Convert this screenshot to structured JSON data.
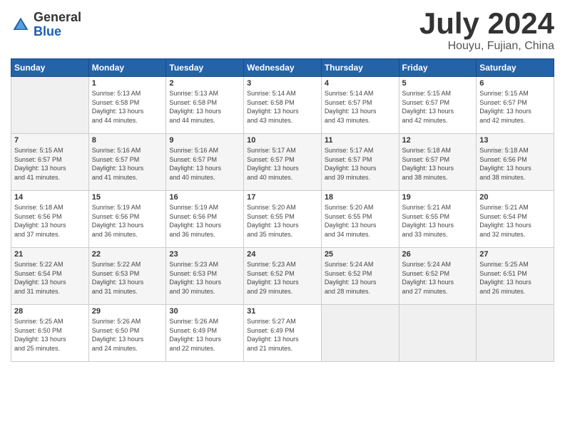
{
  "header": {
    "logo_general": "General",
    "logo_blue": "Blue",
    "month_title": "July 2024",
    "location": "Houyu, Fujian, China"
  },
  "columns": [
    "Sunday",
    "Monday",
    "Tuesday",
    "Wednesday",
    "Thursday",
    "Friday",
    "Saturday"
  ],
  "weeks": [
    {
      "days": [
        {
          "num": "",
          "info": ""
        },
        {
          "num": "1",
          "info": "Sunrise: 5:13 AM\nSunset: 6:58 PM\nDaylight: 13 hours\nand 44 minutes."
        },
        {
          "num": "2",
          "info": "Sunrise: 5:13 AM\nSunset: 6:58 PM\nDaylight: 13 hours\nand 44 minutes."
        },
        {
          "num": "3",
          "info": "Sunrise: 5:14 AM\nSunset: 6:58 PM\nDaylight: 13 hours\nand 43 minutes."
        },
        {
          "num": "4",
          "info": "Sunrise: 5:14 AM\nSunset: 6:57 PM\nDaylight: 13 hours\nand 43 minutes."
        },
        {
          "num": "5",
          "info": "Sunrise: 5:15 AM\nSunset: 6:57 PM\nDaylight: 13 hours\nand 42 minutes."
        },
        {
          "num": "6",
          "info": "Sunrise: 5:15 AM\nSunset: 6:57 PM\nDaylight: 13 hours\nand 42 minutes."
        }
      ]
    },
    {
      "days": [
        {
          "num": "7",
          "info": "Sunrise: 5:15 AM\nSunset: 6:57 PM\nDaylight: 13 hours\nand 41 minutes."
        },
        {
          "num": "8",
          "info": "Sunrise: 5:16 AM\nSunset: 6:57 PM\nDaylight: 13 hours\nand 41 minutes."
        },
        {
          "num": "9",
          "info": "Sunrise: 5:16 AM\nSunset: 6:57 PM\nDaylight: 13 hours\nand 40 minutes."
        },
        {
          "num": "10",
          "info": "Sunrise: 5:17 AM\nSunset: 6:57 PM\nDaylight: 13 hours\nand 40 minutes."
        },
        {
          "num": "11",
          "info": "Sunrise: 5:17 AM\nSunset: 6:57 PM\nDaylight: 13 hours\nand 39 minutes."
        },
        {
          "num": "12",
          "info": "Sunrise: 5:18 AM\nSunset: 6:57 PM\nDaylight: 13 hours\nand 38 minutes."
        },
        {
          "num": "13",
          "info": "Sunrise: 5:18 AM\nSunset: 6:56 PM\nDaylight: 13 hours\nand 38 minutes."
        }
      ]
    },
    {
      "days": [
        {
          "num": "14",
          "info": "Sunrise: 5:18 AM\nSunset: 6:56 PM\nDaylight: 13 hours\nand 37 minutes."
        },
        {
          "num": "15",
          "info": "Sunrise: 5:19 AM\nSunset: 6:56 PM\nDaylight: 13 hours\nand 36 minutes."
        },
        {
          "num": "16",
          "info": "Sunrise: 5:19 AM\nSunset: 6:56 PM\nDaylight: 13 hours\nand 36 minutes."
        },
        {
          "num": "17",
          "info": "Sunrise: 5:20 AM\nSunset: 6:55 PM\nDaylight: 13 hours\nand 35 minutes."
        },
        {
          "num": "18",
          "info": "Sunrise: 5:20 AM\nSunset: 6:55 PM\nDaylight: 13 hours\nand 34 minutes."
        },
        {
          "num": "19",
          "info": "Sunrise: 5:21 AM\nSunset: 6:55 PM\nDaylight: 13 hours\nand 33 minutes."
        },
        {
          "num": "20",
          "info": "Sunrise: 5:21 AM\nSunset: 6:54 PM\nDaylight: 13 hours\nand 32 minutes."
        }
      ]
    },
    {
      "days": [
        {
          "num": "21",
          "info": "Sunrise: 5:22 AM\nSunset: 6:54 PM\nDaylight: 13 hours\nand 31 minutes."
        },
        {
          "num": "22",
          "info": "Sunrise: 5:22 AM\nSunset: 6:53 PM\nDaylight: 13 hours\nand 31 minutes."
        },
        {
          "num": "23",
          "info": "Sunrise: 5:23 AM\nSunset: 6:53 PM\nDaylight: 13 hours\nand 30 minutes."
        },
        {
          "num": "24",
          "info": "Sunrise: 5:23 AM\nSunset: 6:52 PM\nDaylight: 13 hours\nand 29 minutes."
        },
        {
          "num": "25",
          "info": "Sunrise: 5:24 AM\nSunset: 6:52 PM\nDaylight: 13 hours\nand 28 minutes."
        },
        {
          "num": "26",
          "info": "Sunrise: 5:24 AM\nSunset: 6:52 PM\nDaylight: 13 hours\nand 27 minutes."
        },
        {
          "num": "27",
          "info": "Sunrise: 5:25 AM\nSunset: 6:51 PM\nDaylight: 13 hours\nand 26 minutes."
        }
      ]
    },
    {
      "days": [
        {
          "num": "28",
          "info": "Sunrise: 5:25 AM\nSunset: 6:50 PM\nDaylight: 13 hours\nand 25 minutes."
        },
        {
          "num": "29",
          "info": "Sunrise: 5:26 AM\nSunset: 6:50 PM\nDaylight: 13 hours\nand 24 minutes."
        },
        {
          "num": "30",
          "info": "Sunrise: 5:26 AM\nSunset: 6:49 PM\nDaylight: 13 hours\nand 22 minutes."
        },
        {
          "num": "31",
          "info": "Sunrise: 5:27 AM\nSunset: 6:49 PM\nDaylight: 13 hours\nand 21 minutes."
        },
        {
          "num": "",
          "info": ""
        },
        {
          "num": "",
          "info": ""
        },
        {
          "num": "",
          "info": ""
        }
      ]
    }
  ]
}
